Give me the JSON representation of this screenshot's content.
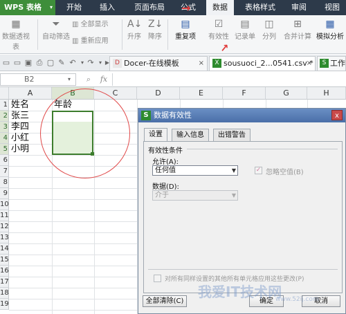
{
  "app": {
    "name": "WPS 表格",
    "arrow": "▾"
  },
  "menu": [
    {
      "label": "开始"
    },
    {
      "label": "插入"
    },
    {
      "label": "页面布局"
    },
    {
      "label": "公式"
    },
    {
      "label": "数据"
    },
    {
      "label": "表格样式"
    },
    {
      "label": "审阅"
    },
    {
      "label": "视图"
    }
  ],
  "ribbon": {
    "pivot": "数据透视表",
    "autofilter": "自动筛选",
    "show_all": "全部显示",
    "reapply": "重新应用",
    "sort_asc": "升序",
    "sort_desc": "降序",
    "duplicates": "重复项",
    "validity": "有效性",
    "record": "记录单",
    "split": "分列",
    "consolidate": "合并计算",
    "simulate": "模拟分析"
  },
  "tabs": [
    {
      "label": "Docer-在线模板",
      "close": "×"
    },
    {
      "label": "sousuoci_2...0541.csv *",
      "close": "×"
    },
    {
      "label": "工作"
    }
  ],
  "formula_bar": {
    "namebox": "B2",
    "fx": "fx"
  },
  "columns": [
    "A",
    "B",
    "C",
    "D",
    "E",
    "F",
    "G",
    "H"
  ],
  "rows": [
    "1",
    "2",
    "3",
    "4",
    "5",
    "6",
    "7",
    "8",
    "9",
    "10",
    "11",
    "12",
    "13",
    "14",
    "15",
    "16",
    "17",
    "18",
    "19"
  ],
  "cells": {
    "a1": "姓名",
    "b1": "年龄",
    "a2": "张三",
    "a3": "李四",
    "a4": "小红",
    "a5": "小明"
  },
  "dialog": {
    "icon": "S",
    "title": "数据有效性",
    "close": "x",
    "tabs": [
      "设置",
      "输入信息",
      "出错警告"
    ],
    "section": "有效性条件",
    "allow_label": "允许(A):",
    "allow_value": "任何值",
    "ignore_blank": "忽略空值(B)",
    "data_label": "数据(D):",
    "data_value": "介于",
    "apply_all": "对所有同样设置的其他所有单元格应用这些更改(P)",
    "clear_all": "全部清除(C)",
    "ok": "确定",
    "cancel": "取消"
  },
  "watermark": {
    "text": "我爱IT技术网",
    "url": "www.52ij.com"
  },
  "colors": {
    "accent_green": "#3d7d2d",
    "annotation_red": "#e03a3a",
    "topbar": "#2d3a4a"
  }
}
